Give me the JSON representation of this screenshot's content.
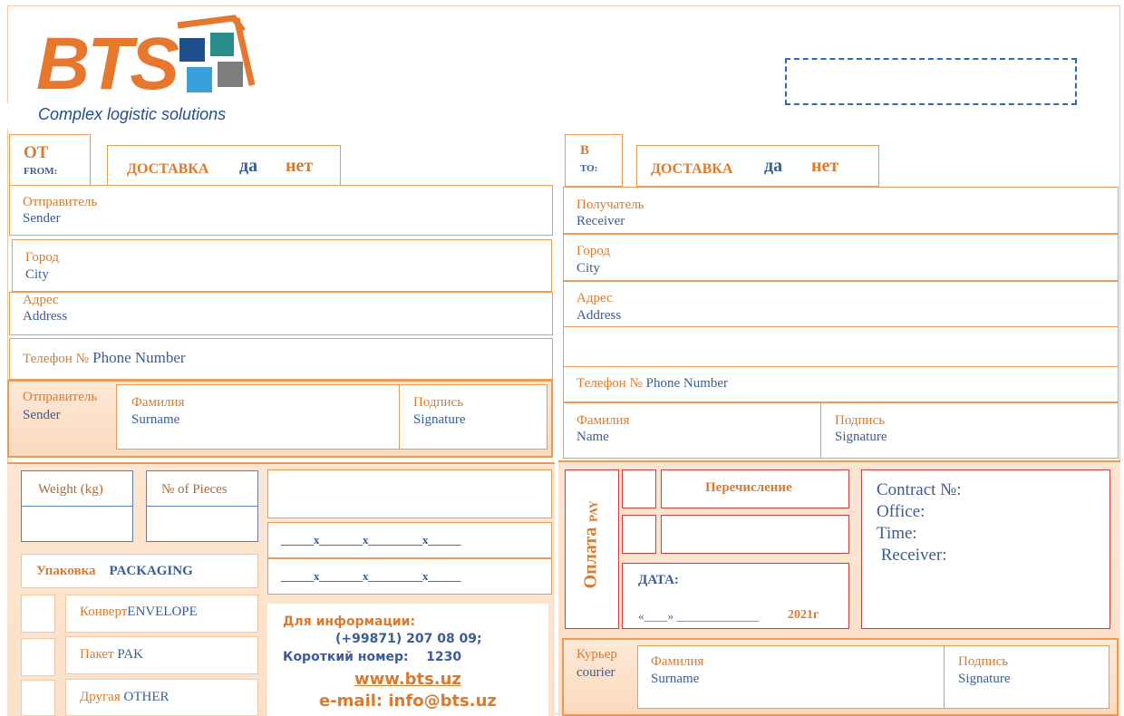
{
  "logo": {
    "brand": "BTS",
    "tagline": "Complex logistic solutions",
    "colors": {
      "orange": "#e8772e",
      "navy": "#1f4e8c",
      "teal": "#2a8f8a",
      "sky": "#3aa0dc",
      "gray": "#7d7d7d"
    }
  },
  "sender": {
    "from_ru": "ОТ",
    "from_en": "FROM:",
    "delivery": "ДОСТАВКА",
    "yes": "да",
    "no": "нет",
    "sender_ru": "Отправитель",
    "sender_en": "Sender",
    "city_ru": "Город",
    "city_en": "City",
    "address_ru": "Адрес",
    "address_en": "Address",
    "phone_ru": "Телефон №",
    "phone_en": "Phone Number",
    "signrow_ru": "Отправитель",
    "signrow_en": "Sender",
    "surname_ru": "Фамилия",
    "surname_en": "Surname",
    "signature_ru": "Подпись",
    "signature_en": "Signature"
  },
  "receiver": {
    "to_ru": "В",
    "to_en": "TO:",
    "delivery": "ДОСТАВКА",
    "yes": "да",
    "no": "нет",
    "receiver_ru": "Получатель",
    "receiver_en": "Receiver",
    "city_ru": "Город",
    "city_en": "City",
    "address_ru": "Адрес",
    "address_en": "Address",
    "phone_ru": "Телефон №",
    "phone_en": "Phone Number",
    "name_ru": "Фамилия",
    "name_en": "Name",
    "signature_ru": "Подпись",
    "signature_en": "Signature"
  },
  "cargo": {
    "weight": "Weight (kg)",
    "pieces": "№ of  Pieces",
    "dims1": "______x________x__________x______",
    "dims2": "______x________x__________x______",
    "packaging_ru": "Упаковка",
    "packaging_en": "PACKAGING",
    "envelope_ru": "Конверт",
    "envelope_en": "ENVELOPE",
    "pak_ru": "Пакет",
    "pak_en": "PAK",
    "other_ru": "Другая",
    "other_en": "OTHER"
  },
  "info": {
    "title": "Для информации:",
    "phone": "(+99871) 207 08 09;",
    "short": "Короткий номер:    1230",
    "web": "www.bts.uz",
    "email": "e-mail: info@bts.uz"
  },
  "payment": {
    "oplata": "Оплата",
    "pay": "PAY",
    "transfer": "Перечисление",
    "date_label": "ДАТА:",
    "date_line": "«____»  ______________",
    "year": "2021г"
  },
  "contract": {
    "contract": "Contract №:",
    "office": "Office:",
    "time": "Time:",
    "receiver": " Receiver:"
  },
  "courier": {
    "courier_ru": "Курьер",
    "courier_en": "courier",
    "surname_ru": "Фамилия",
    "surname_en": "Surname",
    "signature_ru": "Подпись",
    "signature_en": "Signature"
  }
}
